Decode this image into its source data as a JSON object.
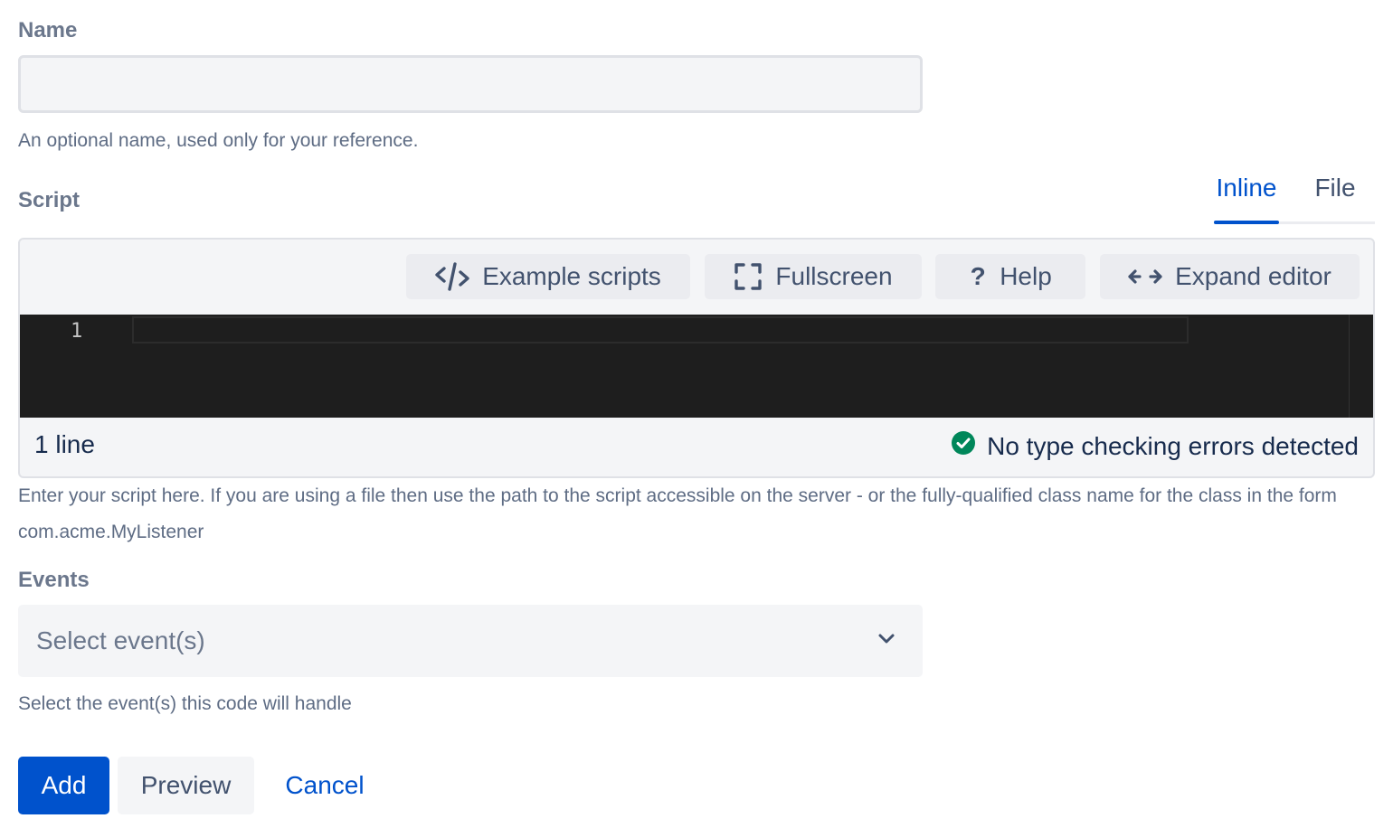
{
  "name_field": {
    "label": "Name",
    "value": "",
    "placeholder": "",
    "helper": "An optional name, used only for your reference."
  },
  "script_field": {
    "label": "Script",
    "tabs": [
      {
        "label": "Inline",
        "active": true
      },
      {
        "label": "File",
        "active": false
      }
    ],
    "toolbar": {
      "example_scripts": "Example scripts",
      "fullscreen": "Fullscreen",
      "help_icon": "?",
      "help": "Help",
      "expand_editor": "Expand editor"
    },
    "editor": {
      "line_numbers": [
        "1"
      ],
      "content": ""
    },
    "status": {
      "line_count": "1 line",
      "type_check": "No type checking errors detected"
    },
    "helper": "Enter your script here. If you are using a file then use the path to the script accessible on the server - or the fully-qualified class name for the class in the form com.acme.MyListener"
  },
  "events_field": {
    "label": "Events",
    "placeholder": "Select event(s)",
    "helper": "Select the event(s) this code will handle"
  },
  "actions": {
    "add": "Add",
    "preview": "Preview",
    "cancel": "Cancel"
  },
  "icons": {
    "example_scripts": "code-icon",
    "fullscreen": "fullscreen-icon",
    "help": "question-icon",
    "expand_editor": "expand-arrows-icon",
    "type_check_ok": "check-circle-icon",
    "events_dropdown": "chevron-down-icon"
  },
  "colors": {
    "primary": "#0052cc",
    "success": "#00875a",
    "editor_bg": "#1e1e1e",
    "muted_text": "#6b778c"
  }
}
